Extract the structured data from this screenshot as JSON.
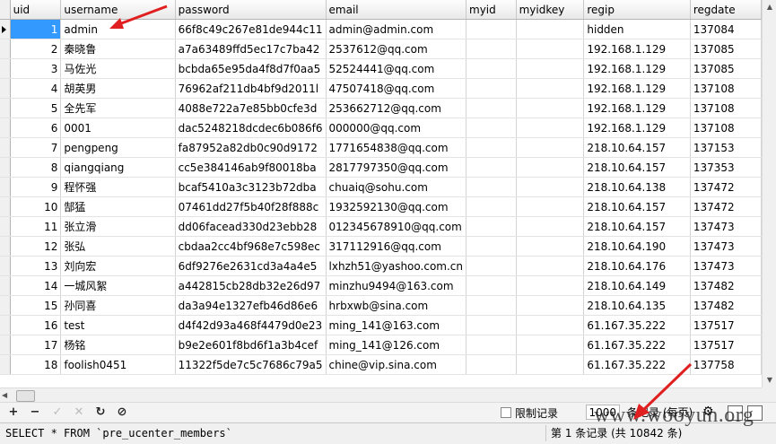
{
  "columns": [
    "uid",
    "username",
    "password",
    "email",
    "myid",
    "myidkey",
    "regip",
    "regdate"
  ],
  "rows": [
    [
      "1",
      "admin",
      "66f8c49c267e81de944c11",
      "admin@admin.com",
      "",
      "",
      "hidden",
      "137084"
    ],
    [
      "2",
      "秦晓鲁",
      "a7a63489ffd5ec17c7ba42",
      "2537612@qq.com",
      "",
      "",
      "192.168.1.129",
      "137085"
    ],
    [
      "3",
      "马佐光",
      "bcbda65e95da4f8d7f0aa5",
      "52524441@qq.com",
      "",
      "",
      "192.168.1.129",
      "137085"
    ],
    [
      "4",
      "胡英男",
      "76962af211db4bf9d2011l",
      "47507418@qq.com",
      "",
      "",
      "192.168.1.129",
      "137108"
    ],
    [
      "5",
      "全先军",
      "4088e722a7e85bb0cfe3d",
      "253662712@qq.com",
      "",
      "",
      "192.168.1.129",
      "137108"
    ],
    [
      "6",
      "0001",
      "dac5248218dcdec6b086f6",
      "000000@qq.com",
      "",
      "",
      "192.168.1.129",
      "137108"
    ],
    [
      "7",
      "pengpeng",
      "fa87952a82db0c90d9172",
      "1771654838@qq.com",
      "",
      "",
      "218.10.64.157",
      "137153"
    ],
    [
      "8",
      "qiangqiang",
      "cc5e384146ab9f80018ba",
      "2817797350@qq.com",
      "",
      "",
      "218.10.64.157",
      "137353"
    ],
    [
      "9",
      "程怀强",
      "bcaf5410a3c3123b72dba",
      "chuaiq@sohu.com",
      "",
      "",
      "218.10.64.138",
      "137472"
    ],
    [
      "10",
      "郜猛",
      "07461dd27f5b40f28f888c",
      "1932592130@qq.com",
      "",
      "",
      "218.10.64.157",
      "137472"
    ],
    [
      "11",
      "张立滑",
      "dd06facead330d23ebb28",
      "012345678910@qq.com",
      "",
      "",
      "218.10.64.157",
      "137473"
    ],
    [
      "12",
      "张弘",
      "cbdaa2cc4bf968e7c598ec",
      "317112916@qq.com",
      "",
      "",
      "218.10.64.190",
      "137473"
    ],
    [
      "13",
      "刘向宏",
      "6df9276e2631cd3a4a4e5",
      "lxhzh51@yashoo.com.cn",
      "",
      "",
      "218.10.64.176",
      "137473"
    ],
    [
      "14",
      "一城风絮",
      "a442815cb28db32e26d97",
      "minzhu9494@163.com",
      "",
      "",
      "218.10.64.149",
      "137482"
    ],
    [
      "15",
      "孙同喜",
      "da3a94e1327efb46d86e6",
      "hrbxwb@sina.com",
      "",
      "",
      "218.10.64.135",
      "137482"
    ],
    [
      "16",
      "test",
      "d4f42d93a468f4479d0e23",
      "ming_141@163.com",
      "",
      "",
      "61.167.35.222",
      "137517"
    ],
    [
      "17",
      "杨铭",
      "b9e2e601f8bd6f1a3b4cef",
      "ming_141@126.com",
      "",
      "",
      "61.167.35.222",
      "137517"
    ],
    [
      "18",
      "foolish0451",
      "11322f5de7c5c7686c79a5",
      "chine@vip.sina.com",
      "",
      "",
      "61.167.35.222",
      "137758"
    ]
  ],
  "toolbar": {
    "add_icon": "+",
    "delete_icon": "−",
    "apply_icon": "✓",
    "cancel_icon": "✕",
    "refresh_icon": "↻",
    "stop_icon": "⊘",
    "limit_label": "限制记录",
    "limit_count": "1000",
    "rows_per_page": "条记录 (每页)",
    "settings_icon": "⚙"
  },
  "status": {
    "sql": "SELECT * FROM `pre_ucenter_members`",
    "record_info": "第 1 条记录 (共 10842 条)"
  },
  "watermark": "www.wooyun.org",
  "colors": {
    "selected_cell": "#3399ff",
    "arrow": "#e02020"
  }
}
